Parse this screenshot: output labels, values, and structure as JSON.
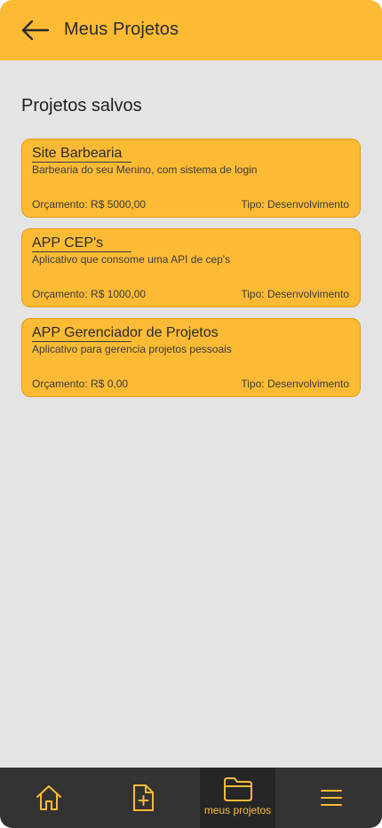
{
  "header": {
    "title": "Meus Projetos"
  },
  "main": {
    "section_title": "Projetos salvos",
    "projects": [
      {
        "title": "Site Barbearia",
        "description": "Barbearia do seu Menino, com sistema de login",
        "budget": "Orçamento: R$ 5000,00",
        "type": "Tipo: Desenvolvimento"
      },
      {
        "title": "APP CEP's",
        "description": "Aplicativo que consome uma API de cep's",
        "budget": "Orçamento: R$ 1000,00",
        "type": "Tipo: Desenvolvimento"
      },
      {
        "title": "APP Gerenciador de Projetos",
        "description": "Aplicativo para gerencia projetos pessoais",
        "budget": "Orçamento: R$ 0,00",
        "type": "Tipo: Desenvolvimento"
      }
    ]
  },
  "bottom_nav": {
    "active_label": "meus projetos",
    "items": [
      "home-icon",
      "new-file-icon",
      "folder-icon",
      "menu-icon"
    ]
  },
  "colors": {
    "accent": "#fdbb35",
    "background": "#e4e4e4",
    "nav_background": "#333333"
  }
}
